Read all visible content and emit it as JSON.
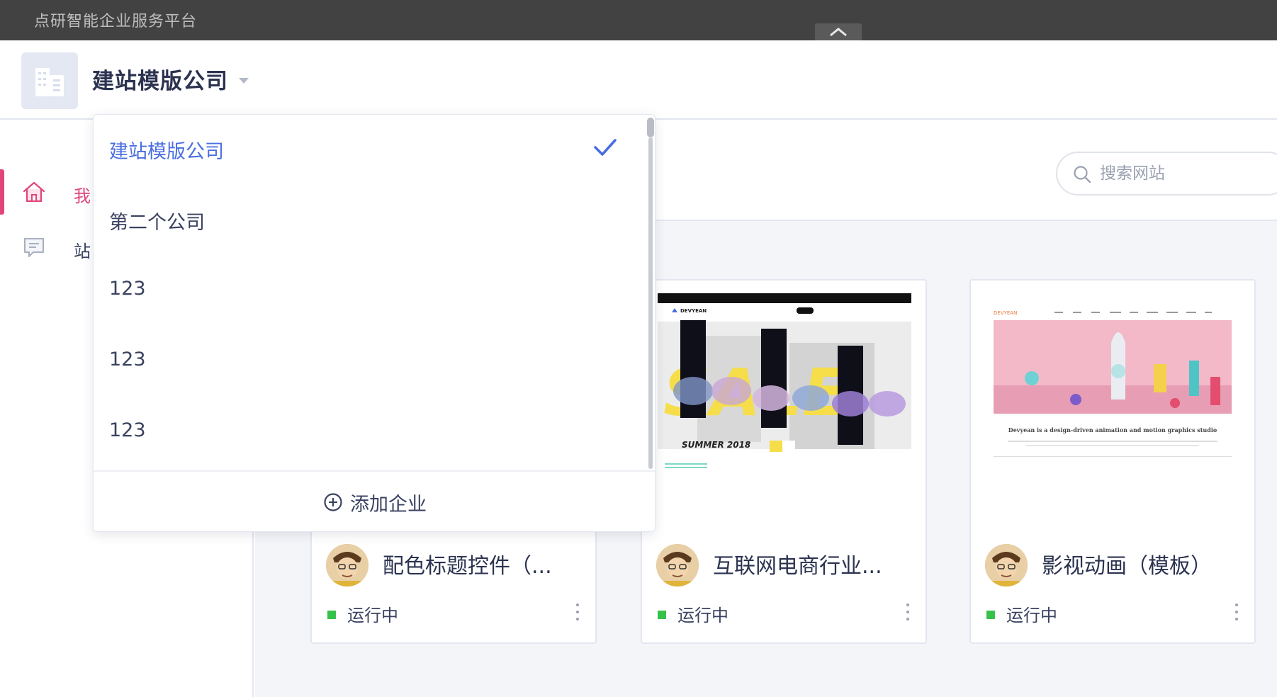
{
  "appbar": {
    "title": "点研智能企业服务平台"
  },
  "header": {
    "company_name": "建站模版公司"
  },
  "sidebar": {
    "items": [
      {
        "label": "我",
        "icon": "home-icon",
        "active": true
      },
      {
        "label": "站",
        "icon": "message-icon",
        "active": false
      }
    ]
  },
  "search": {
    "placeholder": "搜索网站"
  },
  "dropdown": {
    "items": [
      {
        "label": "建站模版公司",
        "selected": true
      },
      {
        "label": "第二个公司",
        "selected": false
      },
      {
        "label": "123",
        "selected": false
      },
      {
        "label": "123",
        "selected": false
      },
      {
        "label": "123",
        "selected": false
      }
    ],
    "add_label": "添加企业"
  },
  "sites": [
    {
      "title": "配色标题控件（...",
      "status": "运行中"
    },
    {
      "title": "互联网电商行业...",
      "status": "运行中",
      "thumb_text": {
        "brand": "DEVYEAN",
        "caption": "SUMMER 2018"
      }
    },
    {
      "title": "影视动画（模板）",
      "status": "运行中",
      "thumb_text": {
        "brand": "DEVYEAN",
        "tagline": "Devyean is a design-driven animation and motion graphics studio"
      }
    }
  ],
  "colors": {
    "accent": "#4a6ee0",
    "active_pink": "#e0457b",
    "status_green": "#36c24a"
  }
}
